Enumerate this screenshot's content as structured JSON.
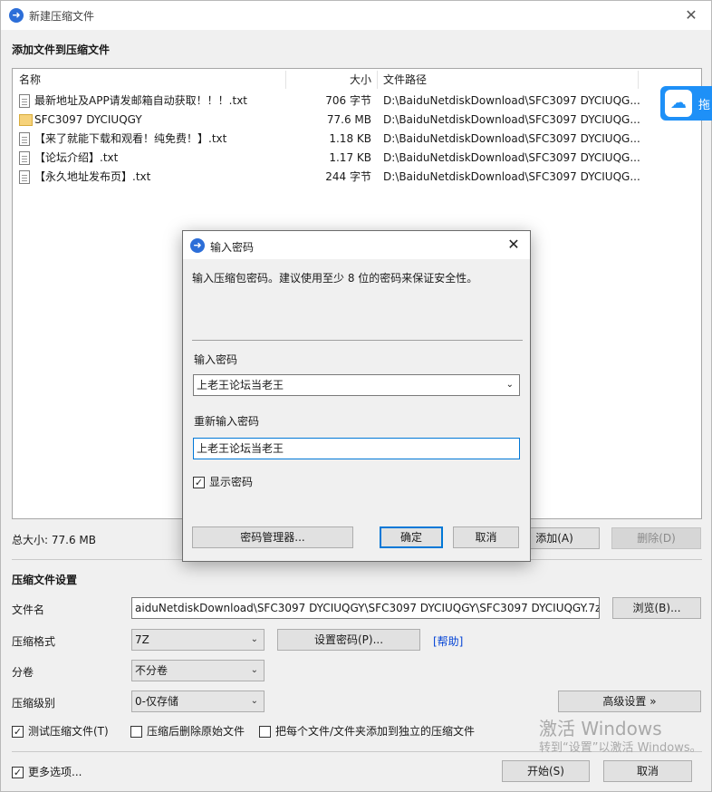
{
  "window": {
    "title": "新建压缩文件"
  },
  "section_add": {
    "heading": "添加文件到压缩文件"
  },
  "filelist": {
    "columns": [
      "名称",
      "大小",
      "文件路径"
    ],
    "rows": [
      {
        "name": "最新地址及APP请发邮箱自动获取！！！.txt",
        "size": "706 字节",
        "path": "D:\\BaiduNetdiskDownload\\SFC3097 DYCIUQG..."
      },
      {
        "name": "SFC3097 DYCIUQGY",
        "size": "77.6 MB",
        "path": "D:\\BaiduNetdiskDownload\\SFC3097 DYCIUQG..."
      },
      {
        "name": "【来了就能下载和观看！纯免费！】.txt",
        "size": "1.18 KB",
        "path": "D:\\BaiduNetdiskDownload\\SFC3097 DYCIUQG..."
      },
      {
        "name": "【论坛介绍】.txt",
        "size": "1.17 KB",
        "path": "D:\\BaiduNetdiskDownload\\SFC3097 DYCIUQG..."
      },
      {
        "name": "【永久地址发布页】.txt",
        "size": "244 字节",
        "path": "D:\\BaiduNetdiskDownload\\SFC3097 DYCIUQG..."
      }
    ]
  },
  "side_tab": {
    "label": "拖"
  },
  "summary": {
    "total_size": "总大小: 77.6 MB",
    "add_label": "添加(A)",
    "delete_label": "删除(D)"
  },
  "settings": {
    "heading": "压缩文件设置",
    "filename_label": "文件名",
    "filename_value": "aiduNetdiskDownload\\SFC3097 DYCIUQGY\\SFC3097 DYCIUQGY\\SFC3097 DYCIUQGY.7z",
    "browse_label": "浏览(B)...",
    "format_label": "压缩格式",
    "format_value": "7Z",
    "set_password_label": "设置密码(P)...",
    "help_label": "[帮助]",
    "split_label": "分卷",
    "split_value": "不分卷",
    "level_label": "压缩级别",
    "level_value": "0-仅存储",
    "advanced_label": "高级设置 »",
    "test_archive": {
      "label": "测试压缩文件(T)",
      "checked": true
    },
    "delete_after": {
      "label": "压缩后删除原始文件",
      "checked": false
    },
    "separate_archives": {
      "label": "把每个文件/文件夹添加到独立的压缩文件",
      "checked": false
    }
  },
  "footer": {
    "more_options": {
      "label": "更多选项...",
      "checked": true
    },
    "start_label": "开始(S)",
    "cancel_label": "取消"
  },
  "watermark": {
    "line1": "激活 Windows",
    "line2": "转到“设置”以激活 Windows。"
  },
  "dialog": {
    "title": "输入密码",
    "description": "输入压缩包密码。建议使用至少 8 位的密码来保证安全性。",
    "password_label": "输入密码",
    "password_value": "上老王论坛当老王",
    "confirm_label": "重新输入密码",
    "confirm_value": "上老王论坛当老王",
    "show_password": {
      "label": "显示密码",
      "checked": true
    },
    "manager_label": "密码管理器...",
    "ok_label": "确定",
    "cancel_label": "取消"
  },
  "icons": {
    "app": "bandizip-icon",
    "close": "close-icon",
    "file": "file-icon",
    "folder": "folder-icon",
    "cloud": "baidu-cloud-icon",
    "chevron": "chevron-down-icon"
  }
}
